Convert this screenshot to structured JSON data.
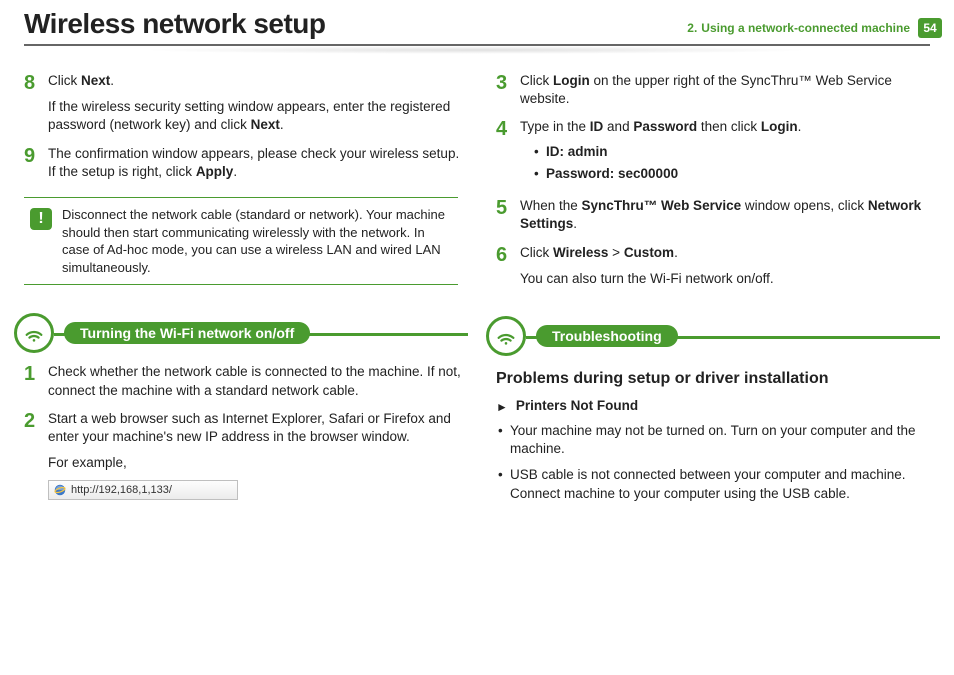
{
  "header": {
    "title": "Wireless network setup",
    "chapter_num": "2.",
    "chapter_label": "Using a network-connected machine",
    "page_num": "54"
  },
  "left": {
    "step8": {
      "num": "8",
      "line1a": "Click ",
      "line1b": "Next",
      "line1c": ".",
      "line2a": "If the wireless security setting window appears, enter the registered password (network key) and click ",
      "line2b": "Next",
      "line2c": "."
    },
    "step9": {
      "num": "9",
      "a": "The confirmation window appears, please check your wireless setup. If the setup is right, click ",
      "b": "Apply",
      "c": "."
    },
    "note": "Disconnect the network cable (standard or network). Your machine should then start communicating wirelessly with the network. In case of Ad-hoc mode, you can use a wireless LAN and wired LAN simultaneously.",
    "section": "Turning the Wi-Fi network on/off",
    "step1": {
      "num": "1",
      "text": "Check whether the network cable is connected to the machine. If not, connect the machine with a standard network cable."
    },
    "step2": {
      "num": "2",
      "text": "Start a web browser such as Internet Explorer, Safari or Firefox and enter your machine's new IP address in the browser window.",
      "eg": "For example,",
      "url": "http://192,168,1,133/"
    }
  },
  "right": {
    "step3": {
      "num": "3",
      "a": "Click ",
      "b": "Login",
      "c": " on the upper right of the SyncThru™ Web Service website."
    },
    "step4": {
      "num": "4",
      "a": "Type in the ",
      "b": "ID",
      "c": " and ",
      "d": "Password",
      "e": " then click ",
      "f": "Login",
      "g": ".",
      "id_label": "ID: admin",
      "pw_label": "Password: sec00000"
    },
    "step5": {
      "num": "5",
      "a": "When the ",
      "b": "SyncThru™ Web Service",
      "c": " window opens, click ",
      "d": "Network Settings",
      "e": "."
    },
    "step6": {
      "num": "6",
      "a": "Click ",
      "b": "Wireless",
      "c": " > ",
      "d": "Custom",
      "e": ".",
      "line2": "You can also turn the Wi-Fi network on/off."
    },
    "section": "Troubleshooting",
    "sub_h": "Problems during setup or driver installation",
    "tri_label": "Printers Not Found",
    "b1": "Your machine may not be turned on. Turn on your computer and the machine.",
    "b2": "USB cable is not connected between your computer and machine. Connect machine to your computer using the USB cable."
  }
}
